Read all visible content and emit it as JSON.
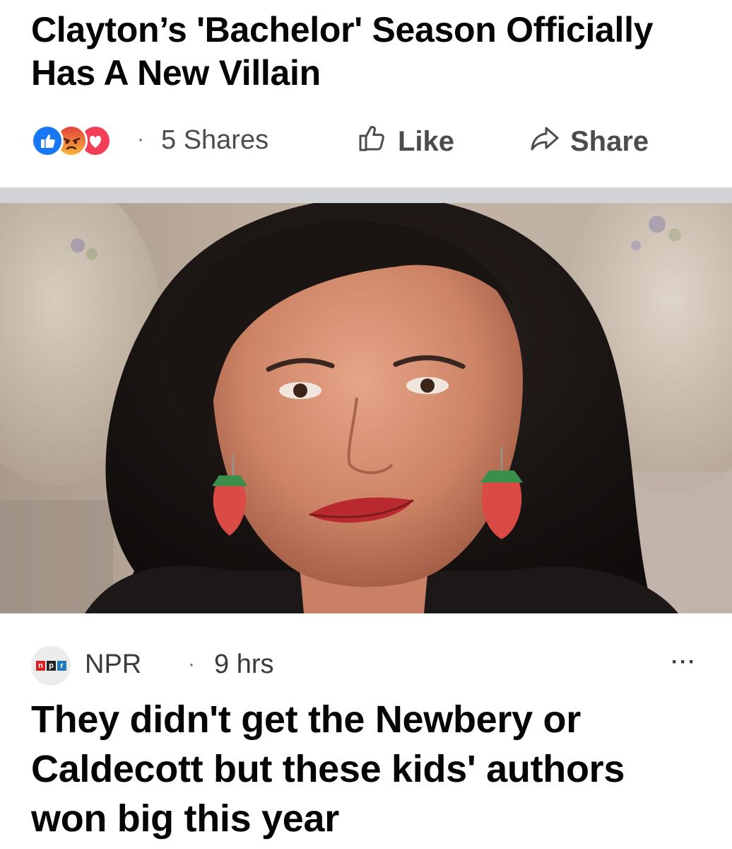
{
  "post1": {
    "headline": "Clayton’s 'Bachelor' Season Officially Has A New Villain",
    "reactions": [
      "like-reaction-icon",
      "angry-reaction-icon",
      "love-reaction-icon"
    ],
    "separator": "·",
    "shares_text": "5 Shares",
    "like_label": "Like",
    "share_label": "Share"
  },
  "photo": {
    "subject": "photo"
  },
  "post2": {
    "source_name": "NPR",
    "separator": "·",
    "time": "9 hrs",
    "logo_letters": [
      "n",
      "p",
      "r"
    ],
    "more_label": "···",
    "title": "They didn't get the Newbery or Caldecott but these kids' authors won big this year"
  },
  "colors": {
    "like_blue": "#1877f2",
    "angry_orange": "#f0752b",
    "love_red": "#f33e58",
    "npr_red": "#d62021",
    "npr_black": "#222222",
    "npr_blue": "#237bbd",
    "divider": "#d1d3d7",
    "secondary_text": "#4b4c4f"
  }
}
